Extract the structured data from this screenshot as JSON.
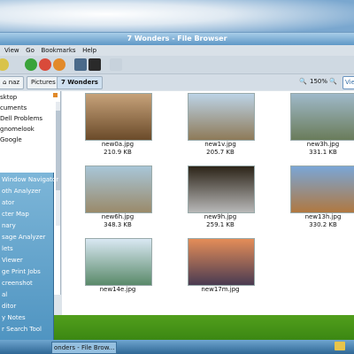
{
  "window": {
    "title": "7 Wonders - File Browser",
    "menu": [
      "View",
      "Go",
      "Bookmarks",
      "Help"
    ]
  },
  "location": {
    "crumbs": [
      "naz",
      "Pictures",
      "7 Wonders"
    ],
    "zoom": "150%",
    "view_label": "Vie"
  },
  "sidebar": {
    "items": [
      "sktop",
      "cuments",
      "Dell Problems",
      "gnomelook",
      "Google"
    ]
  },
  "files": [
    {
      "name": "new0a.jpg",
      "size": "210.9 KB",
      "colors": [
        "#c6a27a",
        "#6b4b2a"
      ]
    },
    {
      "name": "new1v.jpg",
      "size": "205.7 KB",
      "colors": [
        "#bcd3e6",
        "#8e7a58"
      ]
    },
    {
      "name": "new3h.jpg",
      "size": "331.1 KB",
      "colors": [
        "#9fb9c9",
        "#6a7c5a"
      ]
    },
    {
      "name": "new6h.jpg",
      "size": "348.3 KB",
      "colors": [
        "#a8c6d8",
        "#9a8a6a"
      ]
    },
    {
      "name": "new9h.jpg",
      "size": "259.1 KB",
      "colors": [
        "#2c2418",
        "#b8b8b8"
      ]
    },
    {
      "name": "new13h.jpg",
      "size": "330.2 KB",
      "colors": [
        "#7aa6d6",
        "#b07840"
      ]
    },
    {
      "name": "new14e.jpg",
      "size": "",
      "colors": [
        "#d9e8f3",
        "#5a8a6a"
      ]
    },
    {
      "name": "new17m.jpg",
      "size": "",
      "colors": [
        "#e48d58",
        "#4a3b52"
      ]
    }
  ],
  "app_menu": {
    "items": [
      "Window Navigator",
      "oth Analyzer",
      "ator",
      "cter Map",
      "nary",
      "sage Analyzer",
      "lets",
      "Viewer",
      "ge Print Jobs",
      "creenshot",
      "al",
      "ditor",
      "y Notes",
      "r Search Tool"
    ]
  },
  "taskbar": {
    "button_label": "onders - File Brow..."
  }
}
